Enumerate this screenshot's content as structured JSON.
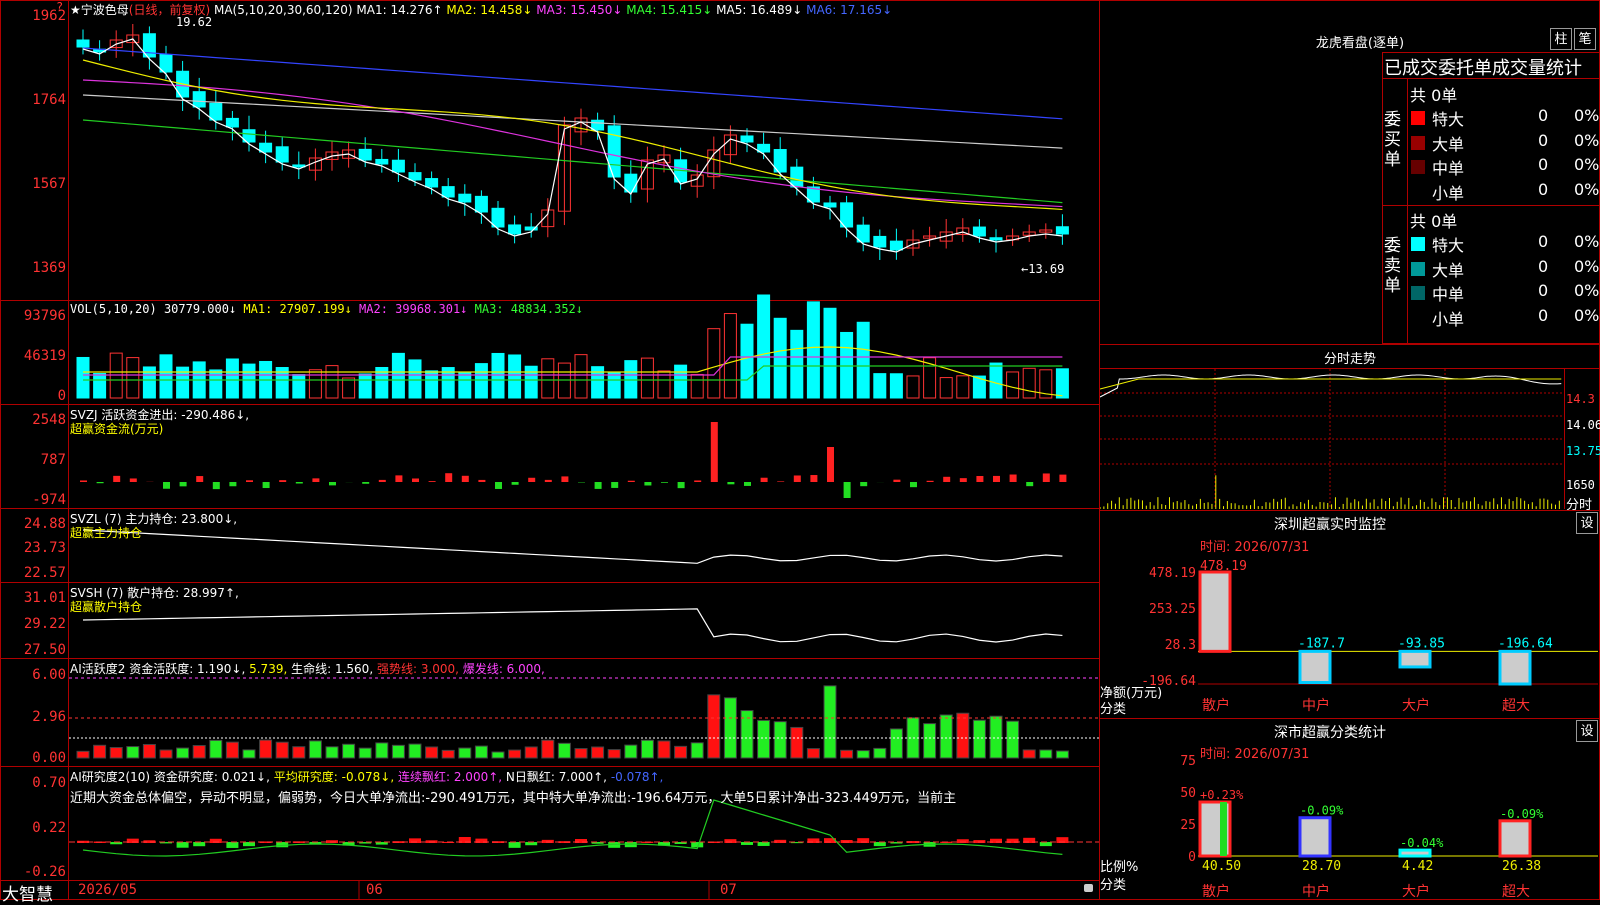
{
  "header": {
    "help_q": "?",
    "stock_name": "★宁波色母",
    "chart_mode": "(日线，前复权)",
    "ma_label": "MA(5,10,20,30,60,120)",
    "ma1": "MA1: 14.276↑",
    "ma2": "MA2: 14.458↓",
    "ma3": "MA3: 15.450↓",
    "ma4": "MA4: 15.415↓",
    "ma5": "MA5: 16.489↓",
    "ma6": "MA6: 17.165↓",
    "high_mark": "19.62",
    "low_mark": "←13.69"
  },
  "price_axis": [
    "1962",
    "1764",
    "1567",
    "1369"
  ],
  "vol": {
    "label": "VOL(5,10,20)",
    "value": "30779.000↓",
    "ma1": "MA1: 27907.199↓",
    "ma2": "MA2: 39968.301↓",
    "ma3": "MA3: 48834.352↓",
    "axis": [
      "93796",
      "46319",
      "0"
    ]
  },
  "svzj": {
    "label": "SVZJ  活跃资金进出: -290.486↓,",
    "sub": "超赢资金流(万元)",
    "axis": [
      "2548",
      "787",
      "-974"
    ]
  },
  "svzl": {
    "label": "SVZL (7) 主力持仓: 23.800↓,",
    "sub": "超赢主力持仓",
    "axis": [
      "24.88",
      "23.73",
      "22.57"
    ]
  },
  "svsh": {
    "label": "SVSH (7) 散户持仓: 28.997↑,",
    "sub": "超赢散户持仓",
    "axis": [
      "31.01",
      "29.22",
      "27.50"
    ]
  },
  "ai_active": {
    "label": "AI活跃度2 资金活跃度: 1.190↓,",
    "v2": "5.739,",
    "life": "生命线: 1.560,",
    "strong": "强势线: 3.000,",
    "burst": "爆发线: 6.000,",
    "axis": [
      "6.00",
      "2.96",
      "0.00"
    ]
  },
  "ai_research": {
    "label": "AI研究度2(10) 资金研究度: 0.021↓,",
    "avg": "平均研究度: -0.078↓,",
    "streak": "连续飘红: 2.000↑,",
    "nday": "N日飘红: 7.000↑,",
    "last": "-0.078↑,",
    "comment": "近期大资金总体偏空，异动不明显，偏弱势，今日大单净流出:-290.491万元，其中特大单净流出:-196.64万元，大单5日累计净出-323.449万元，当前主",
    "axis": [
      "0.70",
      "0.22",
      "-0.26"
    ]
  },
  "dates": [
    "2026/05",
    "06",
    "07"
  ],
  "brand": "大智慧",
  "right": {
    "lhb_title": "龙虎看盘(逐单)",
    "btn_zhu": "柱",
    "btn_bi": "笔",
    "stat_title": "已成交委托单成交量统计",
    "buy_side": "委买单",
    "sell_side": "委卖单",
    "buy_total": "共 0单",
    "sell_total": "共 0单",
    "buy_rows": [
      {
        "name": "特大",
        "count": "0",
        "pct": "0%",
        "color": "#ff0000"
      },
      {
        "name": "大单",
        "count": "0",
        "pct": "0%",
        "color": "#990000"
      },
      {
        "name": "中单",
        "count": "0",
        "pct": "0%",
        "color": "#660000"
      },
      {
        "name": "小单",
        "count": "0",
        "pct": "0%",
        "color": "#000000"
      }
    ],
    "sell_rows": [
      {
        "name": "特大",
        "count": "0",
        "pct": "0%",
        "color": "#00ffff"
      },
      {
        "name": "大单",
        "count": "0",
        "pct": "0%",
        "color": "#009999"
      },
      {
        "name": "中单",
        "count": "0",
        "pct": "0%",
        "color": "#006666"
      },
      {
        "name": "小单",
        "count": "0",
        "pct": "0%",
        "color": "#000000"
      }
    ],
    "intraday_title": "分时走势",
    "intraday_axis": [
      "14.3",
      "14.06",
      "13.75",
      "1650",
      "分时"
    ],
    "monitor_title": "深圳超赢实时监控",
    "monitor_time": "时间: 2026/07/31",
    "monitor_axis": [
      "478.19",
      "253.25",
      "28.3",
      "-196.64"
    ],
    "monitor_unit": "净额(万元)",
    "monitor_cat": "分类",
    "monitor_bars": [
      {
        "cat": "散户",
        "value": 478.19,
        "label": "478.19"
      },
      {
        "cat": "中户",
        "value": -187.7,
        "label": "-187.7"
      },
      {
        "cat": "大户",
        "value": -93.85,
        "label": "-93.85"
      },
      {
        "cat": "超大",
        "value": -196.64,
        "label": "-196.64"
      }
    ],
    "stat2_title": "深市超赢分类统计",
    "stat2_time": "时间: 2026/07/31",
    "stat2_axis": [
      "75",
      "50",
      "25",
      "0"
    ],
    "stat2_unit": "比例%",
    "stat2_cat": "分类",
    "stat2_bars": [
      {
        "cat": "散户",
        "value": 40.5,
        "label": "40.50",
        "chg": "+0.23%"
      },
      {
        "cat": "中户",
        "value": 28.7,
        "label": "28.70",
        "chg": "-0.09%"
      },
      {
        "cat": "大户",
        "value": 4.42,
        "label": "4.42",
        "chg": "-0.04%"
      },
      {
        "cat": "超大",
        "value": 26.38,
        "label": "26.38",
        "chg": "-0.09%"
      }
    ],
    "set_btn": "设"
  }
}
